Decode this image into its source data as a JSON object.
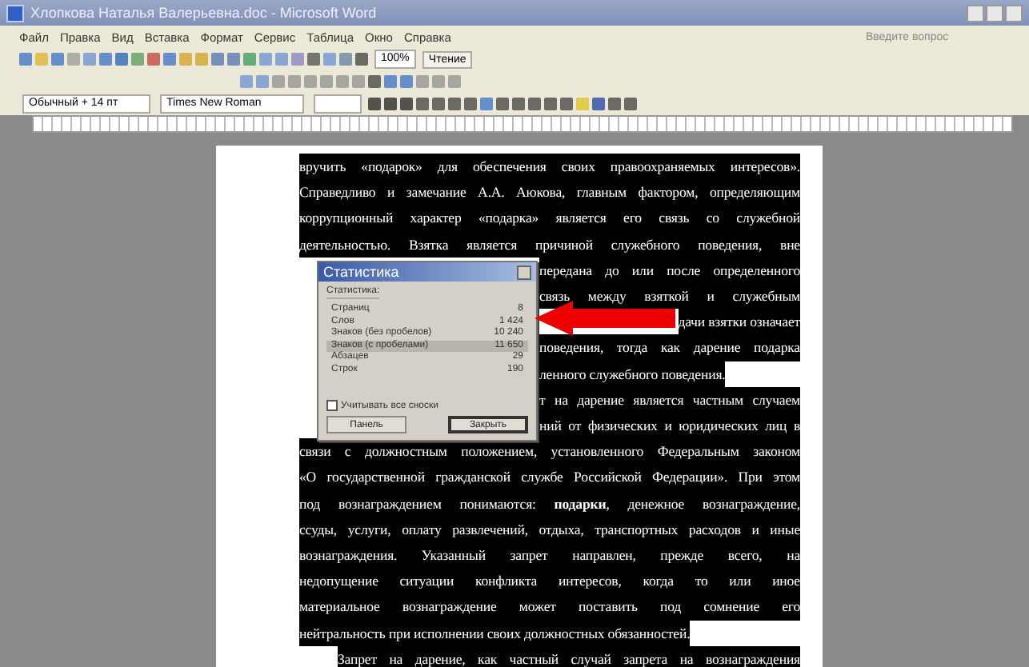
{
  "window": {
    "title": "Хлопкова Наталья Валерьевна.doc - Microsoft Word"
  },
  "menu": [
    "Файл",
    "Правка",
    "Вид",
    "Вставка",
    "Формат",
    "Сервис",
    "Таблица",
    "Окно",
    "Справка"
  ],
  "help_search": {
    "placeholder": "Введите вопрос"
  },
  "toolbar": {
    "zoom": "100%",
    "reading_button": "Чтение"
  },
  "formatting": {
    "style": "Обычный + 14 пт",
    "font": "Times New Roman"
  },
  "document": {
    "lines": [
      {
        "text": "вручить «подарок» для обеспечения своих правоохраняемых интересов».",
        "kind": "full",
        "selected": true
      },
      {
        "text": "Справедливо и замечание А.А. Аюкова, главным фактором, определяющим",
        "kind": "full",
        "selected": true
      },
      {
        "text": "коррупционный характер «подарка» является его связь со служебной",
        "kind": "full",
        "selected": true
      },
      {
        "text": "деятельностью. Взятка является причиной служебного поведения, вне",
        "kind": "full",
        "selected": true
      },
      {
        "text": "передана до или после определенного",
        "kind": "covered",
        "selected": true
      },
      {
        "text": "связь между взяткой и служебным",
        "kind": "covered",
        "selected": true
      },
      {
        "text": "дачи взятки означает",
        "kind": "tail",
        "selected": true
      },
      {
        "text": "поведения, тогда как дарение подарка",
        "kind": "covered",
        "selected": true
      },
      {
        "text": "ленного служебного поведения.",
        "kind": "covered-end",
        "selected": true
      },
      {
        "text": "т на дарение является частным случаем",
        "kind": "covered",
        "selected": true
      },
      {
        "text": "ний от физических и юридических лиц в",
        "kind": "covered",
        "selected": true
      },
      {
        "text": "связи с должностным положением, установленного Федеральным законом",
        "kind": "full",
        "selected": true
      },
      {
        "text": "«О государственной гражданской службе Российской Федерации». При этом",
        "kind": "full",
        "selected": true
      },
      {
        "text": "под вознаграждением понимаются: **подарки**, денежное вознаграждение,",
        "kind": "full",
        "selected": true
      },
      {
        "text": "ссуды, услуги, оплату развлечений, отдыха, транспортных расходов и иные",
        "kind": "full",
        "selected": true
      },
      {
        "text": "вознаграждения. Указанный запрет направлен, прежде всего, на",
        "kind": "full",
        "selected": true
      },
      {
        "text": "недопущение ситуации конфликта интересов, когда то или иное",
        "kind": "full",
        "selected": true
      },
      {
        "text": "материальное вознаграждение может поставить под сомнение его",
        "kind": "full",
        "selected": true
      },
      {
        "text": "нейтральность при исполнении своих должностных обязанностей.",
        "kind": "end",
        "selected": true
      },
      {
        "text": "Запрет на дарение, как частный случай запрета на вознаграждения",
        "kind": "indent",
        "selected": true
      }
    ]
  },
  "dialog": {
    "title": "Статистика",
    "group_label": "Статистика:",
    "rows": [
      {
        "label": "Страниц",
        "value": "8",
        "selected": false
      },
      {
        "label": "Слов",
        "value": "1 424",
        "selected": false
      },
      {
        "label": "Знаков (без пробелов)",
        "value": "10 240",
        "selected": false
      },
      {
        "label": "Знаков (с пробелами)",
        "value": "11 650",
        "selected": true
      },
      {
        "label": "Абзацев",
        "value": "29",
        "selected": false
      },
      {
        "label": "Строк",
        "value": "190",
        "selected": false
      }
    ],
    "checkbox": {
      "label": "Учитывать все сноски",
      "checked": false
    },
    "buttons": [
      {
        "label": "Панель",
        "default": false
      },
      {
        "label": "Закрыть",
        "default": true
      }
    ]
  }
}
